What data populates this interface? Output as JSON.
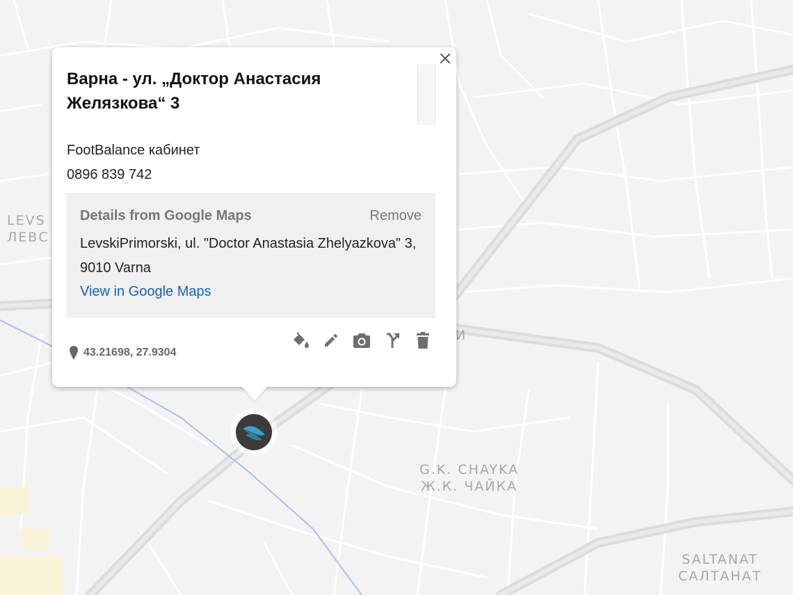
{
  "map": {
    "districts": {
      "levski": {
        "line1": "LEVS",
        "line2": "ЛЕВС"
      },
      "chayka": {
        "line1": "G.K. CHAYKA",
        "line2": "Ж.К. ЧАЙКА"
      },
      "saltanat": {
        "line1": "SALTANAT",
        "line2": "САЛТАНАТ"
      }
    },
    "road_label": "И",
    "colors": {
      "background": "#f3f3f3",
      "road": "#dcdcdc",
      "street": "#ffffff",
      "transit": "#a9c0ec"
    }
  },
  "marker": {
    "icon": "feather-icon",
    "color": "#3b3b3b",
    "accent": "#3aa0c8"
  },
  "info_window": {
    "title": "Варна - ул. „Доктор Анастасия Желязкова“ 3",
    "description_line1": "FootBalance кабинет",
    "description_line2": "0896 839 742",
    "google_details": {
      "heading": "Details from Google Maps",
      "remove_label": "Remove",
      "address": "LevskiPrimorski, ul. \"Doctor Anastasia Zhelyazkova\" 3, 9010 Varna",
      "link_label": "View in Google Maps",
      "link_color": "#1a5fb4"
    },
    "coordinates": "43.21698, 27.9304",
    "toolbar": [
      "paint-bucket-icon",
      "pencil-icon",
      "camera-icon",
      "directions-icon",
      "trash-icon"
    ]
  }
}
